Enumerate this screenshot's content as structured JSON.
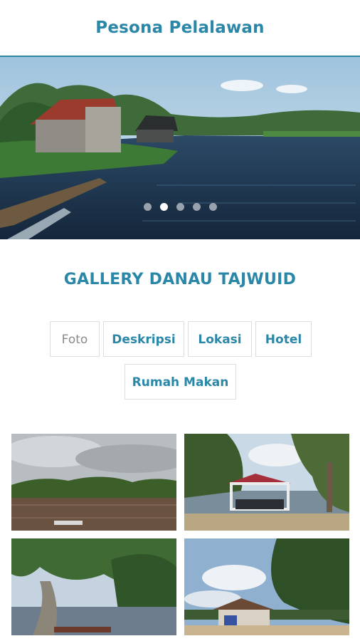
{
  "header": {
    "title": "Pesona Pelalawan",
    "accent": "#2a87a8"
  },
  "carousel": {
    "slide_count": 5,
    "active_index": 1
  },
  "gallery": {
    "title": "GALLERY DANAU TAJWUID",
    "tabs": [
      {
        "label": "Foto",
        "active": true
      },
      {
        "label": "Deskripsi",
        "active": false
      },
      {
        "label": "Lokasi",
        "active": false
      },
      {
        "label": "Hotel",
        "active": false
      },
      {
        "label": "Rumah Makan",
        "active": false
      }
    ]
  }
}
